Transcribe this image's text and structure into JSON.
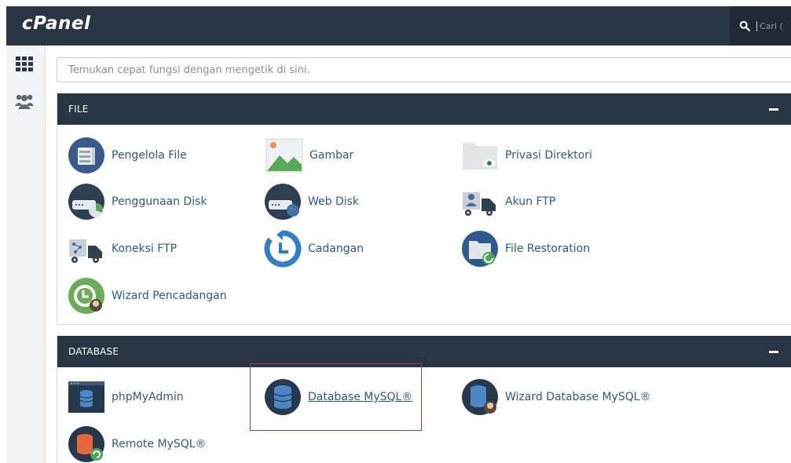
{
  "header": {
    "logo_text": "cPanel",
    "search_placeholder": "Cari ("
  },
  "sidebar": {
    "items": [
      {
        "icon": "grid-icon"
      },
      {
        "icon": "users-icon"
      }
    ]
  },
  "quick_search": {
    "placeholder": "Temukan cepat fungsi dengan mengetik di sini."
  },
  "sections": {
    "file": {
      "title": "FILE",
      "collapse_symbol": "−",
      "items": [
        {
          "label": "Pengelola File",
          "icon": "file-manager-icon"
        },
        {
          "label": "Gambar",
          "icon": "images-icon"
        },
        {
          "label": "Privasi Direktori",
          "icon": "directory-privacy-icon"
        },
        {
          "label": "Penggunaan Disk",
          "icon": "disk-usage-icon"
        },
        {
          "label": "Web Disk",
          "icon": "web-disk-icon"
        },
        {
          "label": "Akun FTP",
          "icon": "ftp-accounts-icon"
        },
        {
          "label": "Koneksi FTP",
          "icon": "ftp-connections-icon"
        },
        {
          "label": "Cadangan",
          "icon": "backup-icon"
        },
        {
          "label": "File Restoration",
          "icon": "file-restoration-icon"
        },
        {
          "label": "Wizard Pencadangan",
          "icon": "backup-wizard-icon"
        }
      ]
    },
    "database": {
      "title": "DATABASE",
      "collapse_symbol": "−",
      "items": [
        {
          "label": "phpMyAdmin",
          "icon": "phpmyadmin-icon"
        },
        {
          "label": "Database MySQL®",
          "icon": "mysql-databases-icon"
        },
        {
          "label": "Wizard Database MySQL®",
          "icon": "mysql-wizard-icon"
        },
        {
          "label": "Remote MySQL®",
          "icon": "remote-mysql-icon"
        }
      ]
    }
  },
  "colors": {
    "header_bg": "#283644",
    "link": "#295a8b",
    "highlight_border": "#b6393c"
  }
}
